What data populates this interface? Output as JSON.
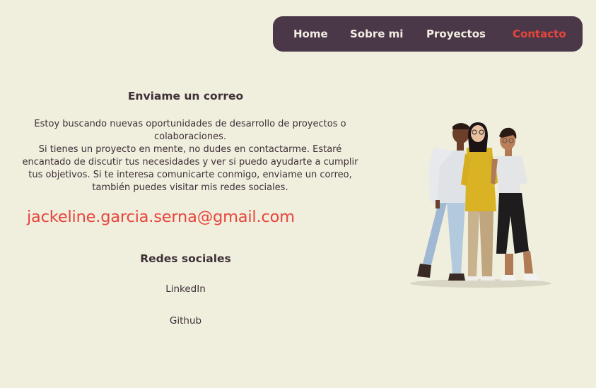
{
  "nav": {
    "items": [
      {
        "label": "Home",
        "active": false
      },
      {
        "label": "Sobre mi",
        "active": false
      },
      {
        "label": "Proyectos",
        "active": false
      },
      {
        "label": "Contacto",
        "active": true
      }
    ]
  },
  "contact": {
    "heading": "Enviame un correo",
    "paragraph_1": "Estoy buscando nuevas oportunidades de desarrollo de proyectos o colaboraciones.",
    "paragraph_2": "Si tienes un proyecto en mente, no dudes en contactarme. Estaré encantado de discutir tus necesidades y ver si puedo ayudarte a cumplir tus objetivos. Si te interesa comunicarte conmigo, enviame un correo, también puedes visitar mis redes sociales.",
    "email": "jackeline.garcia.serna@gmail.com"
  },
  "social": {
    "heading": "Redes sociales",
    "links": [
      "LinkedIn",
      "Github"
    ]
  },
  "colors": {
    "background": "#f0eedd",
    "nav_background": "#4a3848",
    "accent": "#e8453c",
    "text": "#3d3038"
  },
  "illustration": {
    "icon": "people-group-illustration"
  }
}
